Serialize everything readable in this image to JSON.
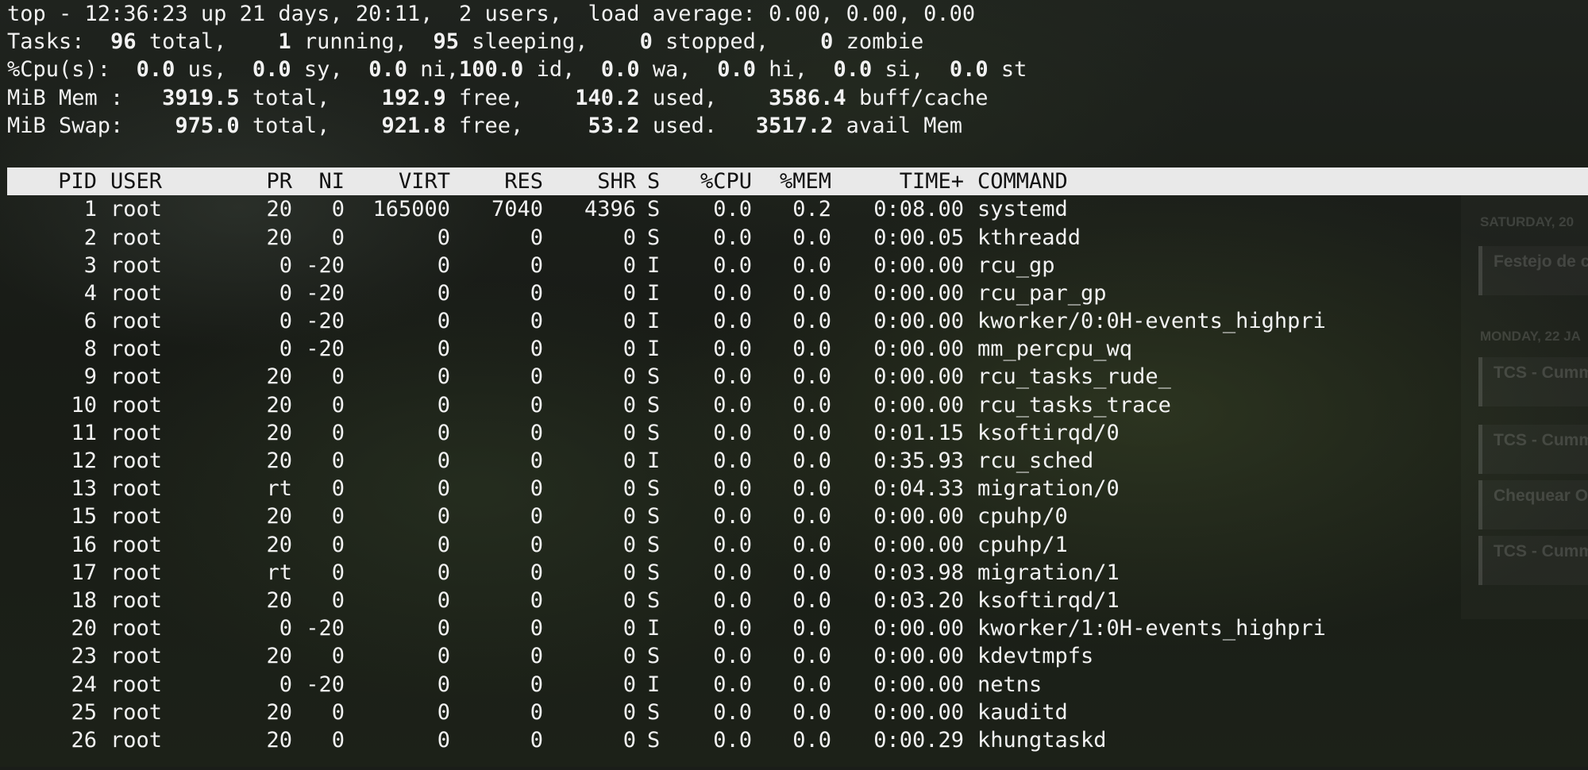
{
  "summary": {
    "line1": "top - 12:36:23 up 21 days, 20:11,  2 users,  load average: 0.00, 0.00, 0.00",
    "tasks": {
      "label": "Tasks:",
      "total": "96",
      "running": "1",
      "sleeping": "95",
      "stopped": "0",
      "zombie": "0"
    },
    "cpu": {
      "label": "%Cpu(s):",
      "us": "0.0",
      "sy": "0.0",
      "ni": "0.0",
      "id": "100.0",
      "wa": "0.0",
      "hi": "0.0",
      "si": "0.0",
      "st": "0.0"
    },
    "mem": {
      "label": "MiB Mem :",
      "total": "3919.5",
      "free": "192.9",
      "used": "140.2",
      "buff_cache": "3586.4"
    },
    "swap": {
      "label": "MiB Swap:",
      "total": "975.0",
      "free": "921.8",
      "used": "53.2",
      "avail_mem": "3517.2"
    }
  },
  "table": {
    "columns": [
      "PID",
      "USER",
      "PR",
      "NI",
      "VIRT",
      "RES",
      "SHR",
      "S",
      "%CPU",
      "%MEM",
      "TIME+",
      "COMMAND"
    ],
    "rows": [
      [
        "1",
        "root",
        "20",
        "0",
        "165000",
        "7040",
        "4396",
        "S",
        "0.0",
        "0.2",
        "0:08.00",
        "systemd"
      ],
      [
        "2",
        "root",
        "20",
        "0",
        "0",
        "0",
        "0",
        "S",
        "0.0",
        "0.0",
        "0:00.05",
        "kthreadd"
      ],
      [
        "3",
        "root",
        "0",
        "-20",
        "0",
        "0",
        "0",
        "I",
        "0.0",
        "0.0",
        "0:00.00",
        "rcu_gp"
      ],
      [
        "4",
        "root",
        "0",
        "-20",
        "0",
        "0",
        "0",
        "I",
        "0.0",
        "0.0",
        "0:00.00",
        "rcu_par_gp"
      ],
      [
        "6",
        "root",
        "0",
        "-20",
        "0",
        "0",
        "0",
        "I",
        "0.0",
        "0.0",
        "0:00.00",
        "kworker/0:0H-events_highpri"
      ],
      [
        "8",
        "root",
        "0",
        "-20",
        "0",
        "0",
        "0",
        "I",
        "0.0",
        "0.0",
        "0:00.00",
        "mm_percpu_wq"
      ],
      [
        "9",
        "root",
        "20",
        "0",
        "0",
        "0",
        "0",
        "S",
        "0.0",
        "0.0",
        "0:00.00",
        "rcu_tasks_rude_"
      ],
      [
        "10",
        "root",
        "20",
        "0",
        "0",
        "0",
        "0",
        "S",
        "0.0",
        "0.0",
        "0:00.00",
        "rcu_tasks_trace"
      ],
      [
        "11",
        "root",
        "20",
        "0",
        "0",
        "0",
        "0",
        "S",
        "0.0",
        "0.0",
        "0:01.15",
        "ksoftirqd/0"
      ],
      [
        "12",
        "root",
        "20",
        "0",
        "0",
        "0",
        "0",
        "I",
        "0.0",
        "0.0",
        "0:35.93",
        "rcu_sched"
      ],
      [
        "13",
        "root",
        "rt",
        "0",
        "0",
        "0",
        "0",
        "S",
        "0.0",
        "0.0",
        "0:04.33",
        "migration/0"
      ],
      [
        "15",
        "root",
        "20",
        "0",
        "0",
        "0",
        "0",
        "S",
        "0.0",
        "0.0",
        "0:00.00",
        "cpuhp/0"
      ],
      [
        "16",
        "root",
        "20",
        "0",
        "0",
        "0",
        "0",
        "S",
        "0.0",
        "0.0",
        "0:00.00",
        "cpuhp/1"
      ],
      [
        "17",
        "root",
        "rt",
        "0",
        "0",
        "0",
        "0",
        "S",
        "0.0",
        "0.0",
        "0:03.98",
        "migration/1"
      ],
      [
        "18",
        "root",
        "20",
        "0",
        "0",
        "0",
        "0",
        "S",
        "0.0",
        "0.0",
        "0:03.20",
        "ksoftirqd/1"
      ],
      [
        "20",
        "root",
        "0",
        "-20",
        "0",
        "0",
        "0",
        "I",
        "0.0",
        "0.0",
        "0:00.00",
        "kworker/1:0H-events_highpri"
      ],
      [
        "23",
        "root",
        "20",
        "0",
        "0",
        "0",
        "0",
        "S",
        "0.0",
        "0.0",
        "0:00.00",
        "kdevtmpfs"
      ],
      [
        "24",
        "root",
        "0",
        "-20",
        "0",
        "0",
        "0",
        "I",
        "0.0",
        "0.0",
        "0:00.00",
        "netns"
      ],
      [
        "25",
        "root",
        "20",
        "0",
        "0",
        "0",
        "0",
        "S",
        "0.0",
        "0.0",
        "0:00.00",
        "kauditd"
      ],
      [
        "26",
        "root",
        "20",
        "0",
        "0",
        "0",
        "0",
        "S",
        "0.0",
        "0.0",
        "0:00.29",
        "khungtaskd"
      ]
    ]
  },
  "background_calendar": {
    "days": [
      "SATURDAY, 20",
      "MONDAY, 22 JA"
    ],
    "events": [
      "Festejo de c",
      "TCS - Cumm",
      "TCS - Cumm",
      "Chequear O",
      "TCS - Cumm"
    ]
  }
}
